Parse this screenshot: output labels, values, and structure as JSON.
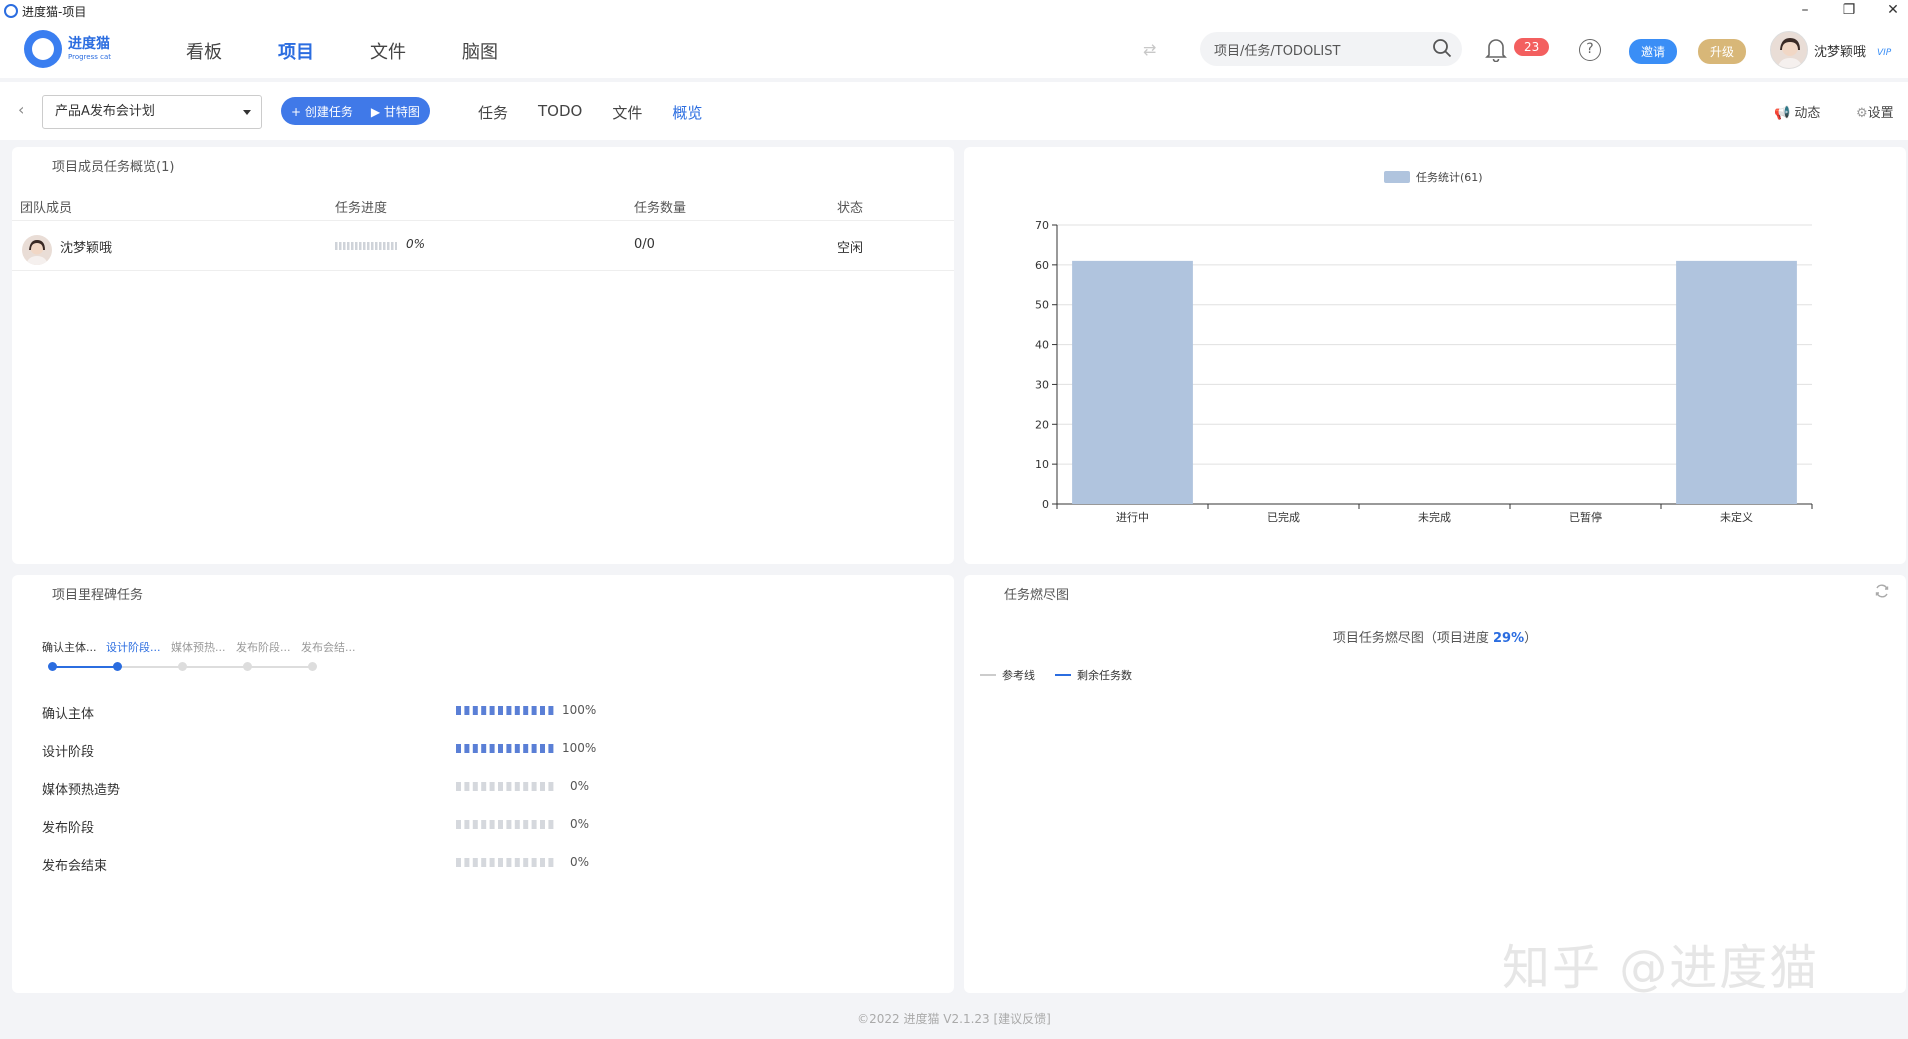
{
  "window": {
    "title": "进度猫-项目",
    "controls": [
      "–",
      "❐",
      "✕"
    ]
  },
  "header": {
    "logo": {
      "cn": "进度猫",
      "en": "Progress cat"
    },
    "nav": [
      {
        "label": "看板",
        "active": false
      },
      {
        "label": "项目",
        "active": true
      },
      {
        "label": "文件",
        "active": false
      },
      {
        "label": "脑图",
        "active": false
      }
    ],
    "search": {
      "value": "项目/任务/TODOLIST"
    },
    "notification_count": "23",
    "invite_label": "邀请",
    "upgrade_label": "升级",
    "user_name": "沈梦颖哦",
    "vip_label": "VIP"
  },
  "subbar": {
    "project": "产品A发布会计划",
    "create_task": "+ 创建任务",
    "gantt": "▶ 甘特图",
    "tabs": [
      {
        "label": "任务",
        "active": false
      },
      {
        "label": "TODO",
        "active": false
      },
      {
        "label": "文件",
        "active": false
      },
      {
        "label": "概览",
        "active": true
      }
    ],
    "activity": "动态",
    "settings": "设置"
  },
  "members_panel": {
    "title": "项目成员任务概览(1)",
    "columns": [
      "团队成员",
      "任务进度",
      "任务数量",
      "状态"
    ],
    "rows": [
      {
        "name": "沈梦颖哦",
        "progress": "0%",
        "progress_value": 0,
        "count": "0/0",
        "status": "空闲"
      }
    ]
  },
  "chart_data": {
    "type": "bar",
    "legend": "任务统计(61)",
    "categories": [
      "进行中",
      "已完成",
      "未完成",
      "已暂停",
      "未定义"
    ],
    "values": [
      61,
      0,
      0,
      0,
      61
    ],
    "ylim": [
      0,
      70
    ],
    "yticks": [
      0,
      10,
      20,
      30,
      40,
      50,
      60,
      70
    ],
    "bar_color": "#b0c4de",
    "grid": true,
    "legend_position": "top-center"
  },
  "milestone_panel": {
    "title": "项目里程碑任务",
    "steps": [
      "确认主体...",
      "设计阶段...",
      "媒体预热...",
      "发布阶段...",
      "发布会结..."
    ],
    "current_step": 1,
    "rows": [
      {
        "name": "确认主体",
        "pct": "100%",
        "value": 1.0
      },
      {
        "name": "设计阶段",
        "pct": "100%",
        "value": 1.0
      },
      {
        "name": "媒体预热造势",
        "pct": "0%",
        "value": 0
      },
      {
        "name": "发布阶段",
        "pct": "0%",
        "value": 0
      },
      {
        "name": "发布会结束",
        "pct": "0%",
        "value": 0
      }
    ]
  },
  "burn_panel": {
    "title": "任务燃尽图",
    "chart_title": "项目任务燃尽图（项目进度 ",
    "chart_pct": "29%",
    "chart_title_end": "）",
    "legend": [
      {
        "label": "参考线",
        "color": "#cccccc"
      },
      {
        "label": "剩余任务数",
        "color": "#2b6de0"
      }
    ]
  },
  "footer": "©2022 进度猫 V2.1.23  [建议反馈]",
  "watermark": "知乎 @进度猫"
}
